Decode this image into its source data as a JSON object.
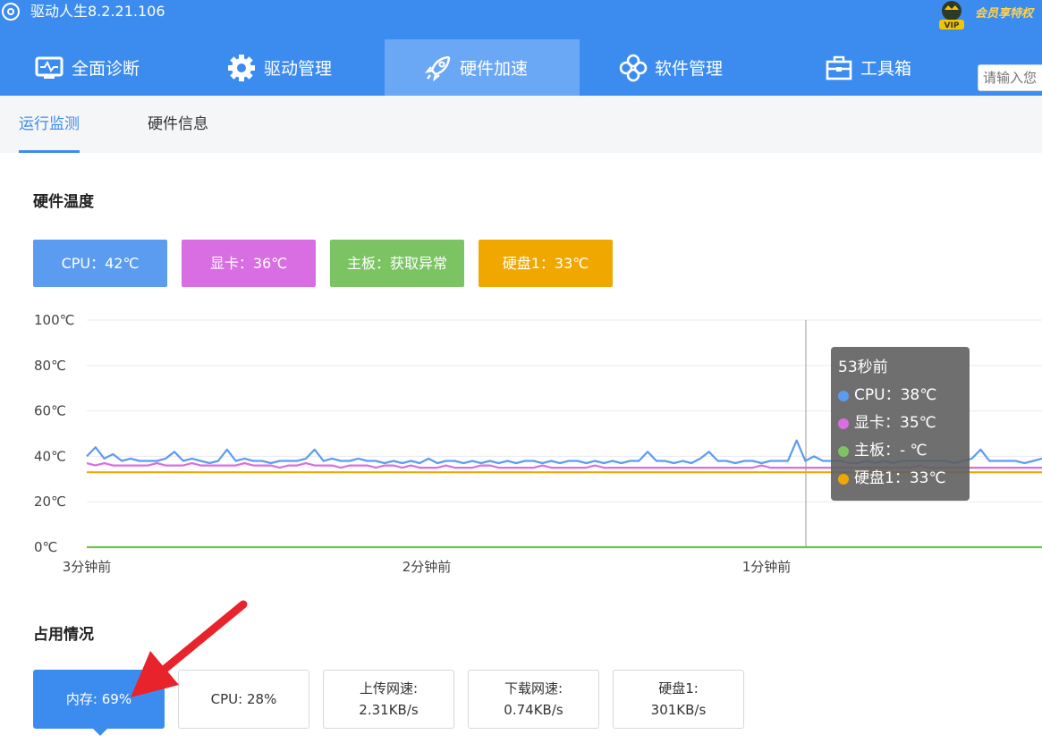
{
  "app": {
    "title": "驱动人生8.2.21.106",
    "vip_text": "会员享特权"
  },
  "nav": {
    "items": [
      {
        "label": "全面诊断",
        "icon": "monitor-pulse-icon"
      },
      {
        "label": "驱动管理",
        "icon": "gear-icon"
      },
      {
        "label": "硬件加速",
        "icon": "rocket-icon",
        "active": true
      },
      {
        "label": "软件管理",
        "icon": "clover-icon"
      },
      {
        "label": "工具箱",
        "icon": "toolbox-icon"
      }
    ],
    "search_placeholder": "请输入您"
  },
  "subtabs": [
    {
      "label": "运行监测",
      "active": true
    },
    {
      "label": "硬件信息"
    }
  ],
  "temperature": {
    "title": "硬件温度",
    "buttons": [
      {
        "label": "CPU：42℃",
        "color": "#5b9cf0"
      },
      {
        "label": "显卡：36℃",
        "color": "#d96ee3"
      },
      {
        "label": "主板：获取异常",
        "color": "#7cc463"
      },
      {
        "label": "硬盘1：33℃",
        "color": "#f0a800"
      }
    ]
  },
  "chart_data": {
    "type": "line",
    "ylim": [
      0,
      100
    ],
    "y_ticks": [
      "100℃",
      "80℃",
      "60℃",
      "40℃",
      "20℃",
      "0℃"
    ],
    "x_ticks": [
      "3分钟前",
      "2分钟前",
      "1分钟前"
    ],
    "series": [
      {
        "name": "CPU",
        "color": "#5b9cf0",
        "values": [
          40,
          44,
          39,
          41,
          38,
          39,
          38,
          38,
          38,
          39,
          42,
          38,
          39,
          38,
          37,
          38,
          43,
          38,
          39,
          38,
          38,
          37,
          38,
          38,
          38,
          39,
          43,
          38,
          39,
          38,
          38,
          39,
          38,
          38,
          37,
          38,
          37,
          38,
          37,
          39,
          37,
          38,
          38,
          37,
          38,
          37,
          38,
          37,
          38,
          37,
          38,
          38,
          37,
          38,
          37,
          38,
          38,
          37,
          38,
          37,
          38,
          37,
          38,
          38,
          42,
          38,
          38,
          37,
          38,
          37,
          39,
          42,
          38,
          38,
          37,
          38,
          38,
          37,
          38,
          38,
          38,
          47,
          38,
          40,
          38,
          38,
          38,
          37,
          37,
          38,
          37,
          38,
          37,
          38,
          38,
          38,
          38,
          38,
          38,
          37,
          38,
          39,
          43,
          38,
          38,
          38,
          38,
          37,
          38,
          39
        ]
      },
      {
        "name": "显卡",
        "color": "#d96ee3",
        "values": [
          37,
          36,
          37,
          36,
          36,
          36,
          36,
          36,
          37,
          36,
          36,
          36,
          37,
          36,
          36,
          36,
          36,
          36,
          37,
          36,
          36,
          36,
          35,
          36,
          36,
          37,
          36,
          36,
          36,
          35,
          36,
          36,
          36,
          35,
          36,
          36,
          35,
          36,
          35,
          35,
          35,
          36,
          35,
          35,
          35,
          36,
          36,
          35,
          35,
          35,
          35,
          35,
          36,
          35,
          35,
          35,
          35,
          35,
          36,
          35,
          35,
          35,
          35,
          35,
          35,
          35,
          35,
          35,
          35,
          35,
          35,
          35,
          35,
          35,
          35,
          35,
          35,
          36,
          35,
          35,
          35,
          35,
          35,
          35,
          35,
          35,
          35,
          35,
          35,
          35,
          35,
          35,
          35,
          35,
          35,
          36,
          35,
          35,
          35,
          35,
          35,
          35,
          35,
          35,
          35,
          35,
          35,
          35,
          35,
          35
        ]
      },
      {
        "name": "主板",
        "color": "#6cc24a",
        "values": [
          0,
          0
        ]
      },
      {
        "name": "硬盘1",
        "color": "#f0a800",
        "values": [
          33,
          33
        ]
      }
    ],
    "tooltip": {
      "title": "53秒前",
      "rows": [
        {
          "label": "CPU：38℃",
          "color": "#5b9cf0"
        },
        {
          "label": "显卡：35℃",
          "color": "#d96ee3"
        },
        {
          "label": "主板：- ℃",
          "color": "#7cc463"
        },
        {
          "label": "硬盘1：33℃",
          "color": "#f0a800"
        }
      ]
    }
  },
  "usage": {
    "title": "占用情况",
    "cards": [
      {
        "line1": "内存: 69%",
        "line2": "",
        "active": true
      },
      {
        "line1": "CPU: 28%",
        "line2": ""
      },
      {
        "line1": "上传网速:",
        "line2": "2.31KB/s"
      },
      {
        "line1": "下载网速:",
        "line2": "0.74KB/s"
      },
      {
        "line1": "硬盘1:",
        "line2": "301KB/s"
      }
    ]
  }
}
